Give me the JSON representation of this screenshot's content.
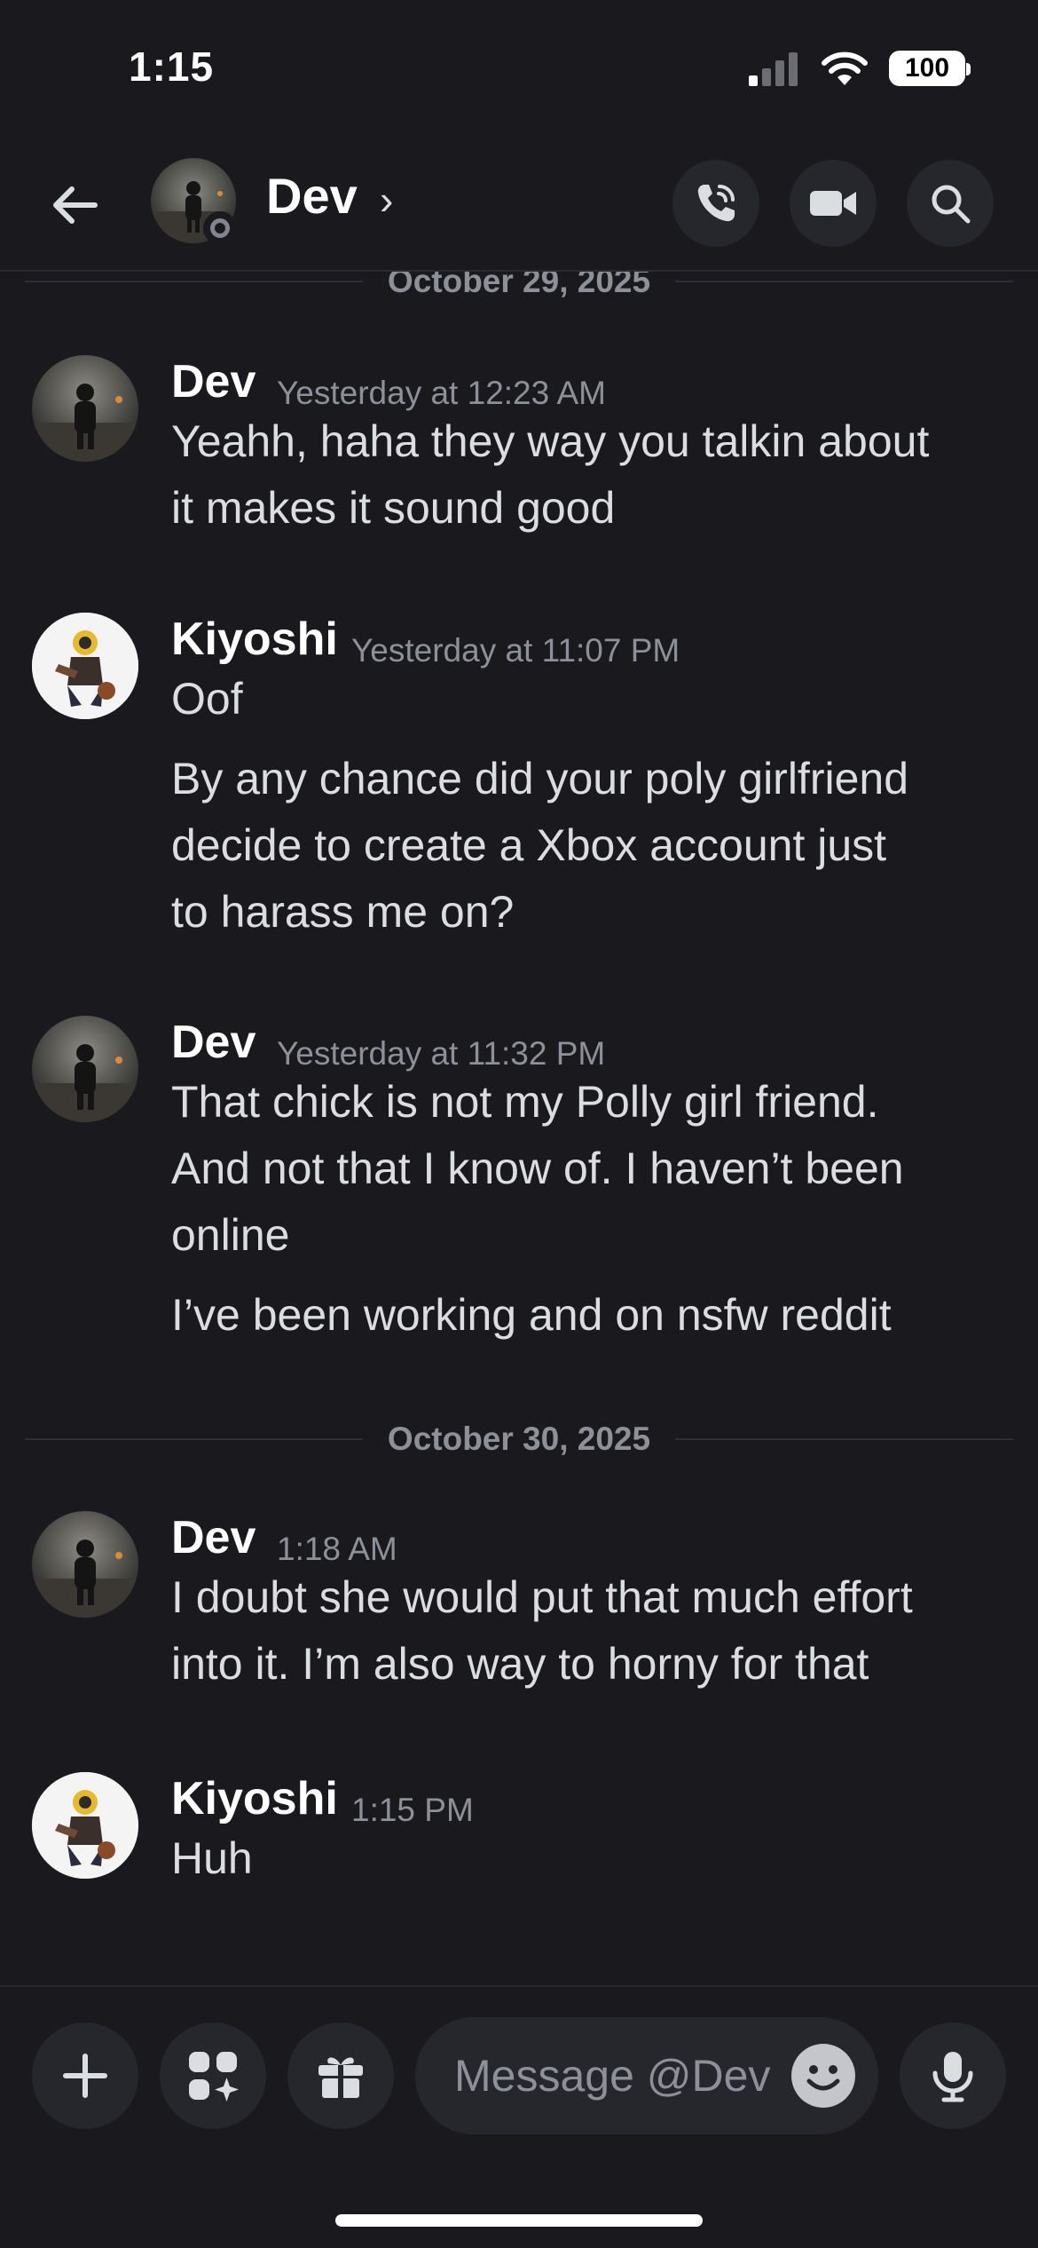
{
  "status_bar": {
    "time": "1:15",
    "battery": "100"
  },
  "header": {
    "name": "Dev",
    "chevron": "›"
  },
  "chat": {
    "dividers": [
      "October 29, 2025",
      "October 30, 2025"
    ],
    "messages": [
      {
        "author": "Dev",
        "time": "Yesterday at 12:23 AM",
        "lines": [
          "Yeahh, haha they way you talkin about",
          "it makes it sound good"
        ]
      },
      {
        "author": "Kiyoshi",
        "time": "Yesterday at 11:07 PM",
        "lines": [
          "Oof",
          "By any chance did your poly girlfriend",
          "decide to create a Xbox account just",
          "to harass me on?"
        ]
      },
      {
        "author": "Dev",
        "time": "Yesterday at 11:32 PM",
        "lines": [
          "That chick is not my Polly girl friend.",
          "And not that I know of. I haven’t been",
          "online",
          "I’ve been working and on nsfw reddit"
        ]
      },
      {
        "author": "Dev",
        "time": "1:18 AM",
        "lines": [
          "I doubt she would put that much effort",
          "into it. I’m also way to horny for that"
        ]
      },
      {
        "author": "Kiyoshi",
        "time": "1:15 PM",
        "lines": [
          "Huh"
        ]
      }
    ]
  },
  "composer": {
    "placeholder": "Message @Dev"
  },
  "icons": {
    "back": "arrow-left-icon",
    "call": "phone-icon",
    "video": "video-camera-icon",
    "search": "search-icon",
    "plus": "plus-icon",
    "apps": "apps-icon",
    "gift": "gift-icon",
    "emoji": "emoji-icon",
    "mic": "microphone-icon"
  },
  "colors": {
    "background": "#1a1a1e",
    "button": "#26272c",
    "muted": "#8d9098",
    "text": "#dcdde1",
    "status_offline": "#80848e"
  }
}
